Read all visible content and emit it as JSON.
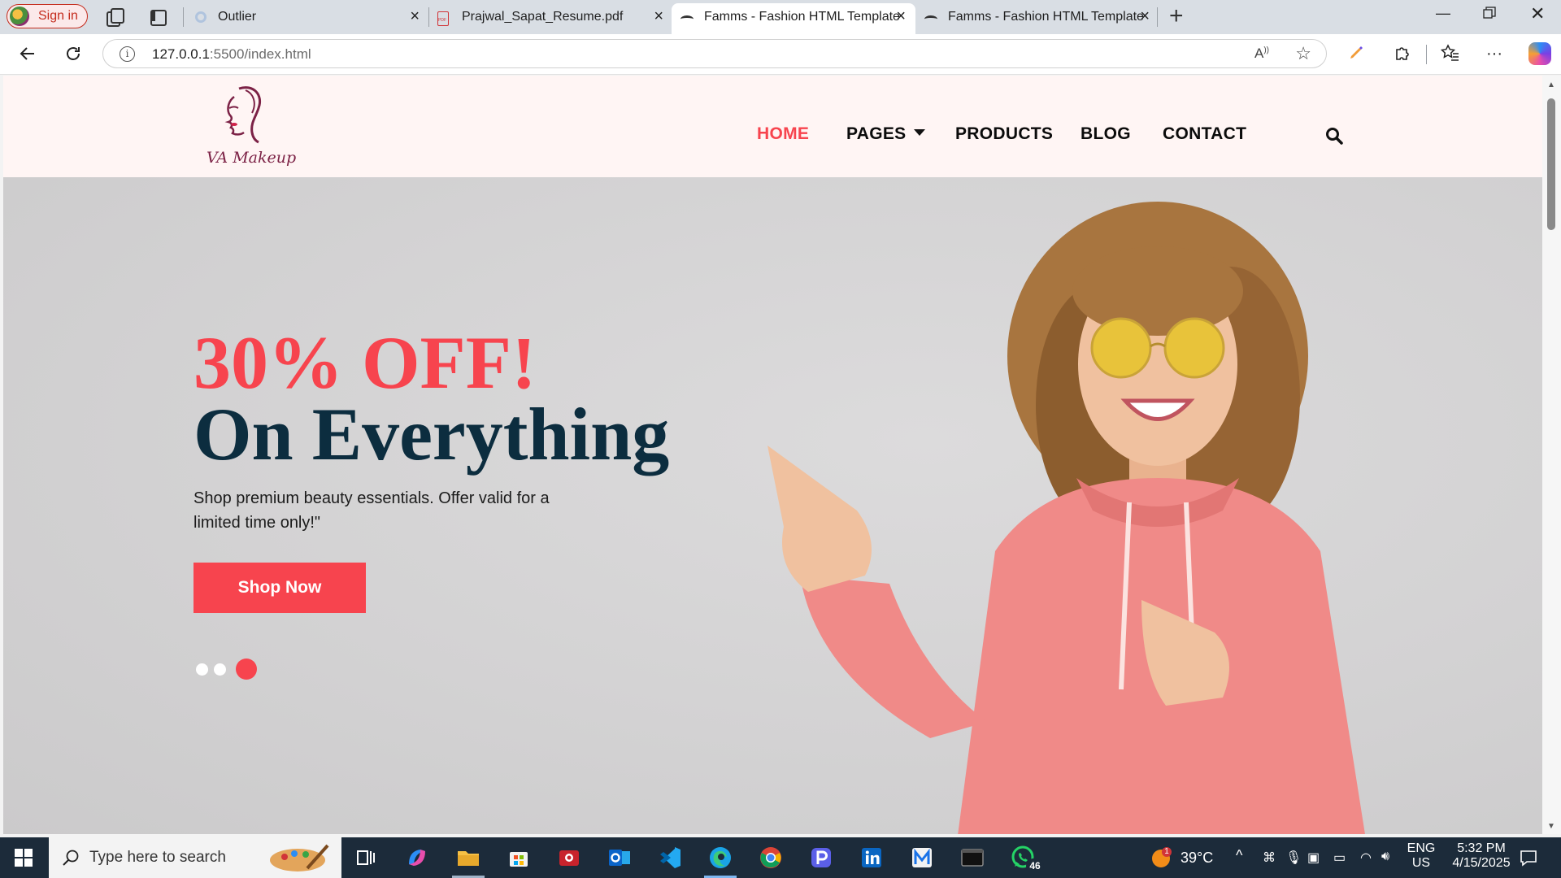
{
  "browser": {
    "sign_in": "Sign in",
    "tabs": [
      {
        "title": "Outlier",
        "favicon": "outlier-icon"
      },
      {
        "title": "Prajwal_Sapat_Resume.pdf",
        "favicon": "pdf-icon"
      },
      {
        "title": "Famms - Fashion HTML Template",
        "favicon": "famms-icon",
        "active": true
      },
      {
        "title": "Famms - Fashion HTML Template",
        "favicon": "famms-icon"
      }
    ],
    "url_host": "127.0.0.1",
    "url_path": ":5500/index.html"
  },
  "site": {
    "logo_text": "VA Makeup",
    "nav": {
      "home": "HOME",
      "pages": "PAGES",
      "products": "PRODUCTS",
      "blog": "BLOG",
      "contact": "CONTACT"
    },
    "hero": {
      "headline": "30% OFF!",
      "subheadline": "On Everything",
      "description": "Shop premium beauty essentials. Offer valid for a limited time only!\"",
      "button": "Shop Now",
      "slides_total": 3,
      "active_slide": 3
    }
  },
  "taskbar": {
    "search_placeholder": "Type here to search",
    "weather": "39°C",
    "language": "ENG",
    "region": "US",
    "time": "5:32 PM",
    "date": "4/15/2025",
    "whatsapp_badge": "46",
    "weather_badge": "1"
  },
  "colors": {
    "accent": "#f7444e",
    "navy": "#0c2d3f",
    "header_bg": "#fff5f4",
    "hero_bg": "#d3d2d3",
    "taskbar": "#1c2b3a"
  }
}
